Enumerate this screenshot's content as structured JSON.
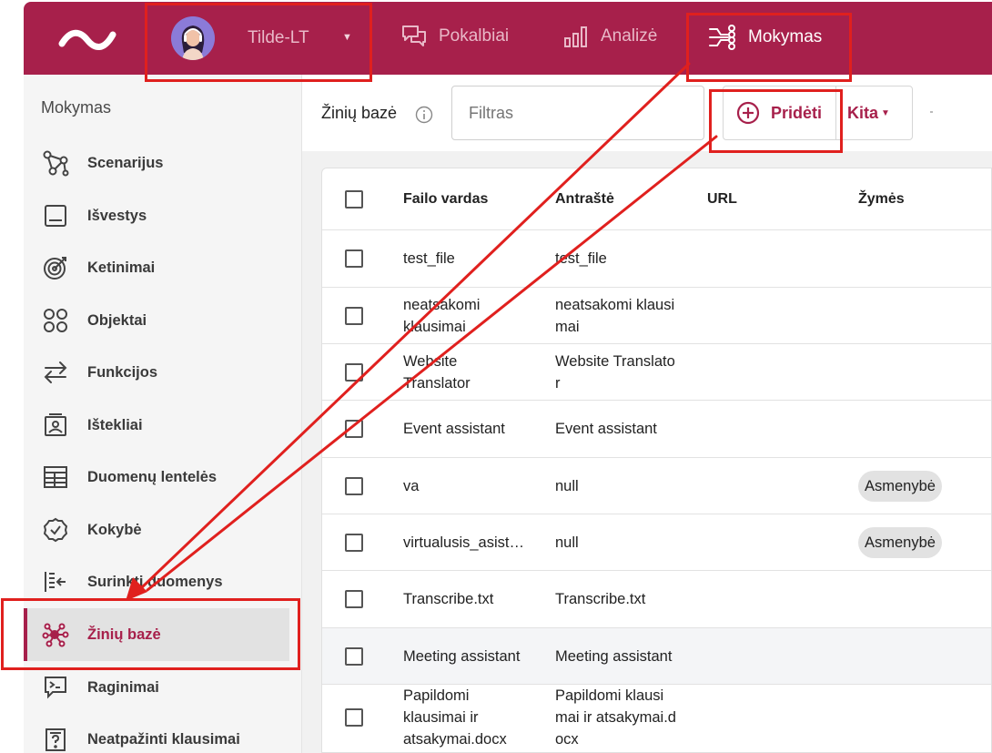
{
  "topbar": {
    "account_name": "Tilde-LT",
    "nav": [
      {
        "label": "Pokalbiai",
        "icon": "chat-icon"
      },
      {
        "label": "Analizė",
        "icon": "bar-chart-icon"
      },
      {
        "label": "Mokymas",
        "icon": "training-icon"
      }
    ],
    "active_nav": "Mokymas"
  },
  "sidebar": {
    "title": "Mokymas",
    "items": [
      {
        "label": "Scenarijus",
        "icon": "scenario-graph-icon"
      },
      {
        "label": "Išvestys",
        "icon": "output-icon"
      },
      {
        "label": "Ketinimai",
        "icon": "target-icon"
      },
      {
        "label": "Objektai",
        "icon": "objects-icon"
      },
      {
        "label": "Funkcijos",
        "icon": "swap-arrows-icon"
      },
      {
        "label": "Ištekliai",
        "icon": "resources-icon"
      },
      {
        "label": "Duomenų lentelės",
        "icon": "data-table-icon"
      },
      {
        "label": "Kokybė",
        "icon": "quality-check-icon"
      },
      {
        "label": "Surinkti duomenys",
        "icon": "collected-data-icon"
      },
      {
        "label": "Žinių bazė",
        "icon": "knowledge-base-icon"
      },
      {
        "label": "Raginimai",
        "icon": "prompt-icon"
      },
      {
        "label": "Neatpažinti klausimai",
        "icon": "unrecognized-questions-icon"
      }
    ],
    "active_item": "Žinių bazė"
  },
  "toolbar": {
    "title": "Žinių bazė",
    "filter_placeholder": "Filtras",
    "add_label": "Pridėti",
    "more_label": "Kita"
  },
  "table": {
    "columns": [
      "Failo vardas",
      "Antraštė",
      "URL",
      "Žymės"
    ],
    "rows": [
      {
        "file": "test_file",
        "title": "test_file",
        "url": "",
        "tag": ""
      },
      {
        "file": "neatsakomi\nklausimai",
        "title": "neatsakomi klausi\nmai",
        "url": "",
        "tag": ""
      },
      {
        "file": "Website\nTranslator",
        "title": "Website Translato\nr",
        "url": "",
        "tag": ""
      },
      {
        "file": "Event assistant",
        "title": "Event assistant",
        "url": "",
        "tag": ""
      },
      {
        "file": "va",
        "title": "null",
        "url": "",
        "tag": "Asmenybė"
      },
      {
        "file": "virtualusis_asist…",
        "title": "null",
        "url": "",
        "tag": "Asmenybė"
      },
      {
        "file": "Transcribe.txt",
        "title": "Transcribe.txt",
        "url": "",
        "tag": ""
      },
      {
        "file": "Meeting assistant",
        "title": "Meeting assistant",
        "url": "",
        "tag": ""
      },
      {
        "file": "Papildomi\nklausimai ir\natsakymai.docx",
        "title": "Papildomi klausi\nmai ir atsakymai.d\nocx",
        "url": "",
        "tag": ""
      }
    ]
  },
  "colors": {
    "brand": "#a7204b",
    "annotation": "#e0201e"
  }
}
